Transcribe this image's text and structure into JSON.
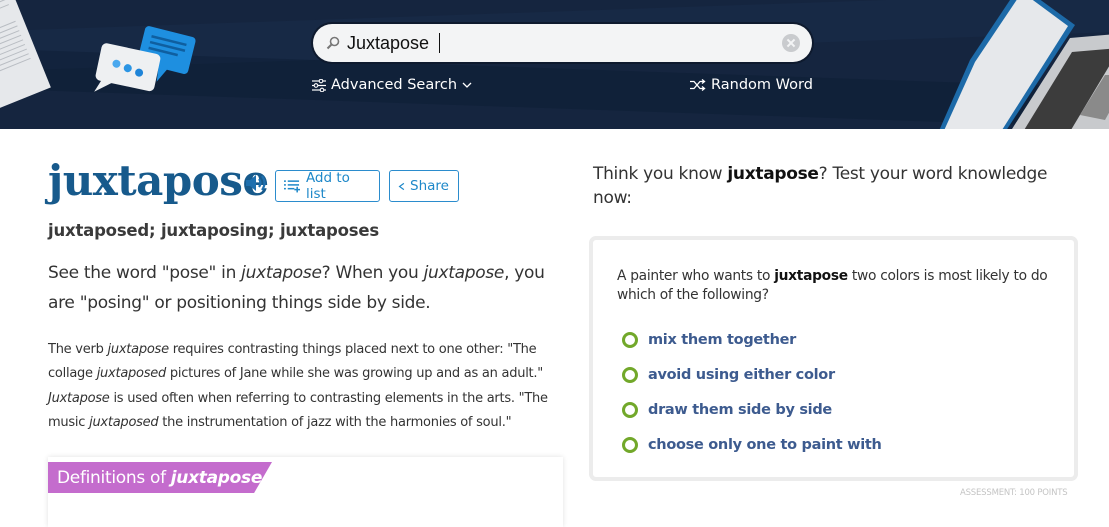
{
  "header": {
    "search": {
      "value": "Juxtapose",
      "placeholder": ""
    },
    "advanced_search_label": "Advanced Search",
    "random_word_label": "Random Word"
  },
  "word": {
    "headword": "juxtapose",
    "add_to_list_label": "Add to list",
    "share_label": "Share",
    "inflections": "juxtaposed; juxtaposing; juxtaposes",
    "short_definition": {
      "p1": "See the word \"pose\" in ",
      "i1": "juxtapose",
      "p2": "? When you ",
      "i2": "juxtapose",
      "p3": ", you are \"posing\" or positioning things side by side."
    },
    "long_definition": {
      "p1": "The verb ",
      "i1": "juxtapose",
      "p2": " requires contrasting things placed next to one other: \"The collage ",
      "i2": "juxtaposed",
      "p3": " pictures of Jane while she was growing up and as an adult.\" ",
      "i3": "Juxtapose",
      "p4": " is used often when referring to contrasting elements in the arts. \"The music ",
      "i4": "juxtaposed",
      "p5": " the instrumentation of jazz with the harmonies of soul.\""
    },
    "definitions_heading": "Definitions of",
    "definitions_heading_word": "juxtapose"
  },
  "quiz": {
    "intro_pre": "Think you know ",
    "intro_word": "juxtapose",
    "intro_post": "? Test your word knowledge now:",
    "question_pre": "A painter who wants to ",
    "question_word": "juxtapose",
    "question_post": " two colors is most likely to do which of the following?",
    "options": [
      {
        "label": "mix them together"
      },
      {
        "label": "avoid using either color"
      },
      {
        "label": "draw them side by side"
      },
      {
        "label": "choose only one to paint with"
      }
    ],
    "assessment_label": "ASSESSMENT: 100 POINTS"
  },
  "colors": {
    "header_bg": "#15253f",
    "headword": "#175a8c",
    "accent_blue": "#1e88c9",
    "definitions_tab": "#c46ccd",
    "radio_green": "#72a82a",
    "option_text": "#3d5b8f"
  }
}
